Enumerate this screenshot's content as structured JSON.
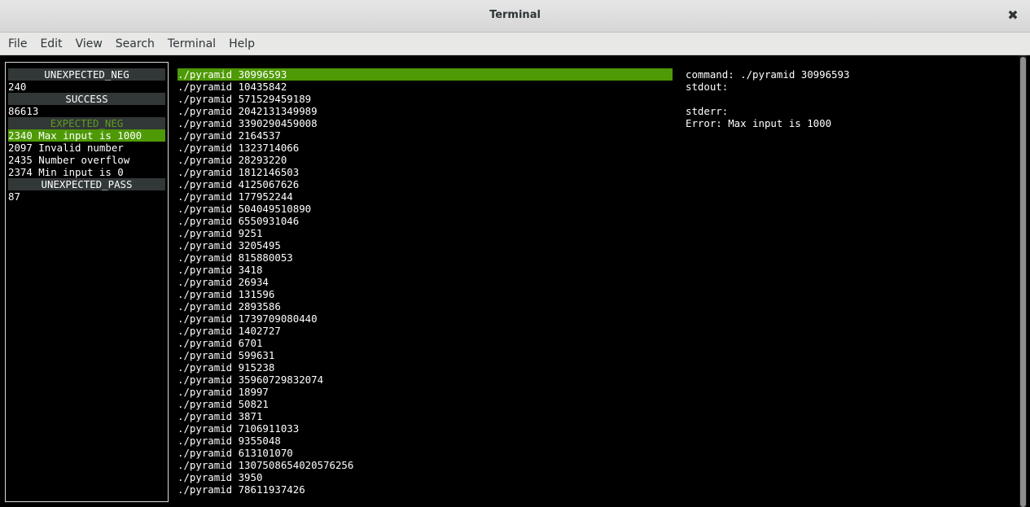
{
  "window": {
    "title": "Terminal",
    "close_glyph": "✖"
  },
  "menu": [
    "File",
    "Edit",
    "View",
    "Search",
    "Terminal",
    "Help"
  ],
  "left_panel": {
    "rows": [
      {
        "type": "header",
        "text": "UNEXPECTED_NEG"
      },
      {
        "type": "item",
        "text": "240"
      },
      {
        "type": "header",
        "text": "SUCCESS"
      },
      {
        "type": "item",
        "text": "86613"
      },
      {
        "type": "header-dim",
        "text": "EXPECTED_NEG"
      },
      {
        "type": "item-selected",
        "text": "2340 Max input is 1000"
      },
      {
        "type": "item",
        "text": "2097 Invalid number"
      },
      {
        "type": "item",
        "text": "2435 Number overflow"
      },
      {
        "type": "item",
        "text": "2374 Min input is 0"
      },
      {
        "type": "header",
        "text": "UNEXPECTED_PASS"
      },
      {
        "type": "item",
        "text": "87"
      }
    ]
  },
  "commands": {
    "selected_index": 0,
    "items": [
      "./pyramid 30996593",
      "./pyramid 10435842",
      "./pyramid 571529459189",
      "./pyramid 2042131349989",
      "./pyramid 3390290459008",
      "./pyramid 2164537",
      "./pyramid 1323714066",
      "./pyramid 28293220",
      "./pyramid 1812146503",
      "./pyramid 4125067626",
      "./pyramid 177952244",
      "./pyramid 504049510890",
      "./pyramid 6550931046",
      "./pyramid 9251",
      "./pyramid 3205495",
      "./pyramid 815880053",
      "./pyramid 3418",
      "./pyramid 26934",
      "./pyramid 131596",
      "./pyramid 2893586",
      "./pyramid 1739709080440",
      "./pyramid 1402727",
      "./pyramid 6701",
      "./pyramid 599631",
      "./pyramid 915238",
      "./pyramid 35960729832074",
      "./pyramid 18997",
      "./pyramid 50821",
      "./pyramid 3871",
      "./pyramid 7106911033",
      "./pyramid 9355048",
      "./pyramid 613101070",
      "./pyramid 1307508654020576256",
      "./pyramid 3950",
      "./pyramid 78611937426"
    ]
  },
  "detail": {
    "lines": [
      "command: ./pyramid 30996593",
      "stdout:",
      "",
      "stderr:",
      "Error: Max input is 1000"
    ]
  },
  "colors": {
    "highlight": "#4e9a06",
    "header_bg": "#323738",
    "header_dim_text": "#5e9d1f",
    "terminal_bg": "#000000",
    "terminal_fg": "#ffffff"
  }
}
